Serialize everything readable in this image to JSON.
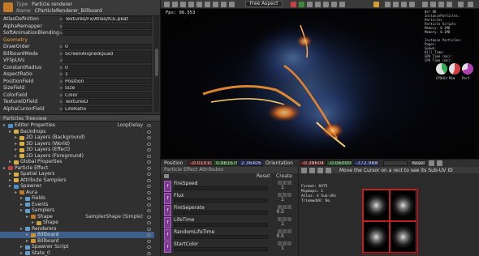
{
  "inspector": {
    "type_key": "Type",
    "type_value": "Particle renderer",
    "name_key": "Name",
    "name_value": "CParticleRenderer_Billboard",
    "properties": [
      {
        "name": "AtlasDefinition",
        "value": "Textures/Fx/Atlas/ICE.pkat"
      },
      {
        "name": "AlphaRemapper",
        "value": ""
      },
      {
        "name": "SoftAnimationBlending",
        "value": ""
      },
      {
        "name": "Geometry",
        "value": "",
        "section": true
      },
      {
        "name": "DrawOrder",
        "value": "0"
      },
      {
        "name": "BillboardMode",
        "value": "ScreenAlignedQuad"
      },
      {
        "name": "VFlipUVs",
        "value": ""
      },
      {
        "name": "ConstantRadius",
        "value": "0"
      },
      {
        "name": "AspectRatio",
        "value": "1"
      },
      {
        "name": "PositionField",
        "value": "Position"
      },
      {
        "name": "SizeField",
        "value": "Size"
      },
      {
        "name": "ColorField",
        "value": "Color"
      },
      {
        "name": "TextureIDField",
        "value": "TextureID"
      },
      {
        "name": "AlphaCursorField",
        "value": "LifeRatio"
      }
    ]
  },
  "treeview": {
    "title": "Particles Treeview",
    "items": [
      {
        "label": "Editor Properties",
        "indent": 0,
        "color": "#4a90d0",
        "right": "LoopDelay"
      },
      {
        "label": "Backdrops",
        "indent": 1,
        "color": "#d8b040"
      },
      {
        "label": "2D Layers (Background)",
        "indent": 2,
        "color": "#d8b040"
      },
      {
        "label": "3D Layers (World)",
        "indent": 2,
        "color": "#d8b040"
      },
      {
        "label": "3D Layers (Effect)",
        "indent": 2,
        "color": "#d8b040"
      },
      {
        "label": "2D Layers (Foreground)",
        "indent": 2,
        "color": "#d8b040"
      },
      {
        "label": "Global Properties",
        "indent": 1,
        "color": "#d8b040"
      },
      {
        "label": "Particle Effect",
        "indent": 0,
        "color": "#c04040"
      },
      {
        "label": "Spatial Layers",
        "indent": 1,
        "color": "#d8b040"
      },
      {
        "label": "Attribute Samplers",
        "indent": 1,
        "color": "#d8b040"
      },
      {
        "label": "Spawner",
        "indent": 1,
        "color": "#4a90d0"
      },
      {
        "label": "Aura",
        "indent": 2,
        "color": "#c07a28"
      },
      {
        "label": "Fields",
        "indent": 3,
        "color": "#60a0d0"
      },
      {
        "label": "Events",
        "indent": 3,
        "color": "#60a0d0"
      },
      {
        "label": "Samplers",
        "indent": 3,
        "color": "#60a0d0"
      },
      {
        "label": "Shape",
        "indent": 4,
        "color": "#c07a28",
        "right": "SamplerShape (Simple)"
      },
      {
        "label": "Shape",
        "indent": 5,
        "color": "#c0a040"
      },
      {
        "label": "Renderers",
        "indent": 3,
        "color": "#60a0d0"
      },
      {
        "label": "Billboard",
        "indent": 4,
        "color": "#d09030",
        "selected": true
      },
      {
        "label": "Billboard",
        "indent": 4,
        "color": "#d09030"
      },
      {
        "label": "Spawner Script",
        "indent": 3,
        "color": "#60a0d0"
      },
      {
        "label": "State_0",
        "indent": 3,
        "color": "#60a0d0"
      }
    ]
  },
  "viewport": {
    "aspect_label": "Free Aspect",
    "fps_text": "Fps: 96.553",
    "stats_lines": [
      "0x? RD",
      "InstanceParticles:",
      "Particles",
      "Particle Scripts",
      "Memory: 0.1MB",
      "Memory: 0.1MB",
      "",
      "Instance Particles:",
      "Pages:",
      "Spawn:",
      "Kill Time:",
      "GPU Time (ms):",
      "CPU Time (ms):"
    ],
    "pie_labels": [
      "CPUHit",
      "Mem",
      "Perf"
    ],
    "pie_colors": [
      "#30b050",
      "#d04040",
      "#b040b0"
    ]
  },
  "transform": {
    "position_label": "Position",
    "pos_x": "-0.01010(",
    "pos_y": "0.981679",
    "pos_z": "2.364067",
    "orientation_label": "Orientation",
    "ori_x": "-0.38604",
    "ori_y": "-0.06000(",
    "ori_z": "-372.988(",
    "reset_label": "Reset"
  },
  "attributes": {
    "title": "Particle Effect Attributes",
    "reset_label": "Reset",
    "create_label": "Create",
    "items": [
      {
        "name": "FireSpeed",
        "value": "1"
      },
      {
        "name": "Flux",
        "value": "1"
      },
      {
        "name": "FireSeperate",
        "value": "0.5"
      },
      {
        "name": "LifeTime",
        "value": "1"
      },
      {
        "name": "RandomLifeTime",
        "value": "0.5"
      },
      {
        "name": "StartColor",
        "value": "1"
      }
    ]
  },
  "subuv": {
    "hint": "Move the Cursor on a rect to see its Sub-UV ID",
    "info_lines": [
      "Format: DXT5",
      "Mipmaps: 1",
      "Atlas: 4 Sub-UVs",
      "TrimmedUV: No"
    ]
  },
  "colors": {
    "accent": "#f0a030",
    "selection": "#3d5f8a"
  }
}
